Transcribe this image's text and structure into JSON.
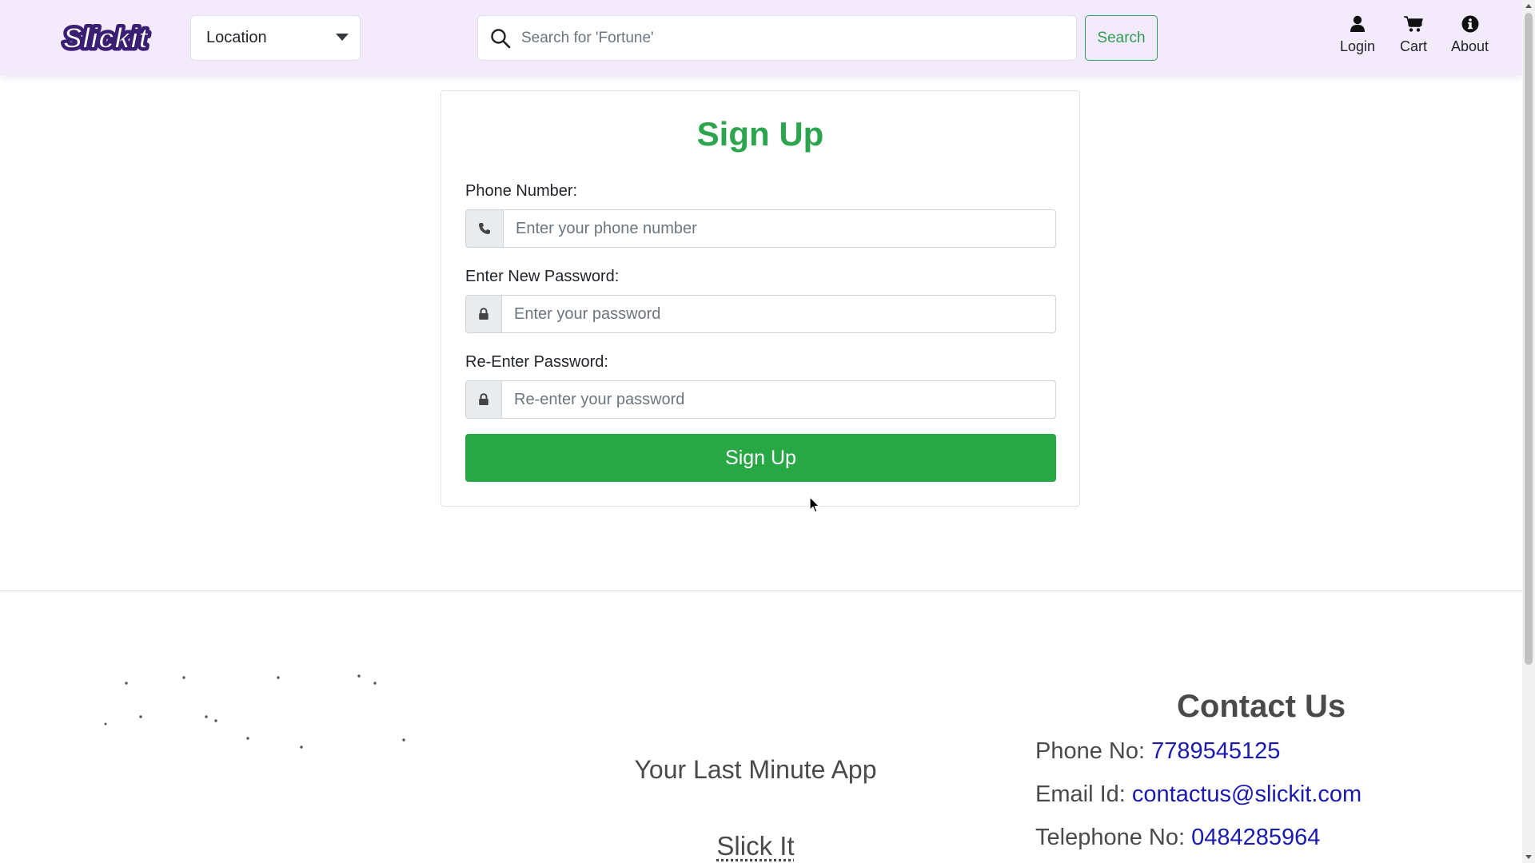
{
  "navbar": {
    "logo_text": "Slickit",
    "location": {
      "label": "Location"
    },
    "search": {
      "placeholder": "Search for 'Fortune'",
      "button_label": "Search"
    },
    "items": [
      {
        "label": "Login",
        "icon": "user-icon"
      },
      {
        "label": "Cart",
        "icon": "cart-icon"
      },
      {
        "label": "About",
        "icon": "info-icon"
      }
    ]
  },
  "signup": {
    "title": "Sign Up",
    "phone": {
      "label": "Phone Number:",
      "placeholder": "Enter your phone number",
      "icon": "phone-icon"
    },
    "password": {
      "label": "Enter New Password:",
      "placeholder": "Enter your password",
      "icon": "lock-icon"
    },
    "confirm": {
      "label": "Re-Enter Password:",
      "placeholder": "Re-enter your password",
      "icon": "lock-icon"
    },
    "button_label": "Sign Up"
  },
  "footer": {
    "tagline": "Your Last Minute App",
    "brand": "Slick It",
    "contact": {
      "title": "Contact Us",
      "phone_label": "Phone No:",
      "phone_value": "7789545125",
      "email_label": "Email Id:",
      "email_value": "contactus@slickit.com",
      "tel_label": "Telephone No:",
      "tel_value": "0484285964"
    }
  },
  "colors": {
    "navbar_bg": "#f3eafb",
    "brand_green": "#28a745",
    "title_green": "#2da44e",
    "link_blue": "#1a1ab0",
    "logo_purple": "#3b1f73"
  }
}
